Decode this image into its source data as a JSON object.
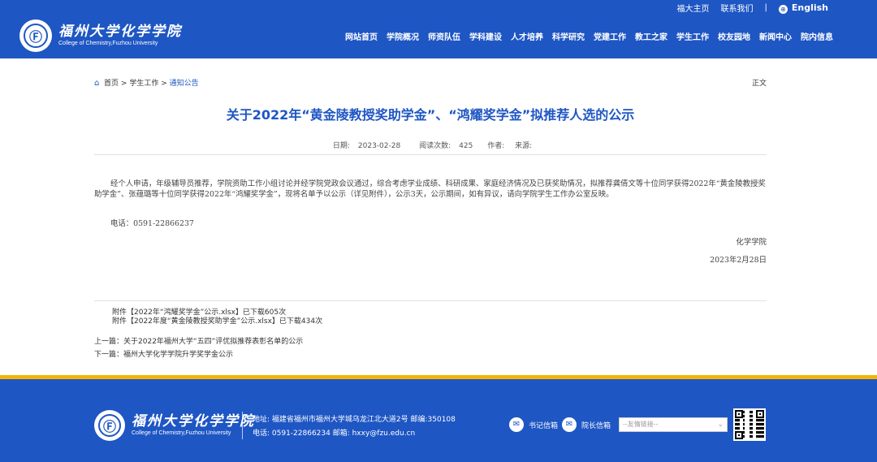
{
  "header": {
    "logo_cn": "福州大学化学学院",
    "logo_en": "College of Chemistry,Fuzhou University",
    "top_links": [
      "福大主页",
      "联系我们"
    ],
    "separator": "|",
    "english_label": "English",
    "nav": [
      "网站首页",
      "学院概况",
      "师资队伍",
      "学科建设",
      "人才培养",
      "科学研究",
      "党建工作",
      "教工之家",
      "学生工作",
      "校友园地",
      "新闻中心",
      "院内信息"
    ]
  },
  "breadcrumb": {
    "home": "首页",
    "sep1": ">",
    "section": "学生工作",
    "sep2": ">",
    "current": "通知公告"
  },
  "zhengwen": "正文",
  "article": {
    "title": "关于2022年“黄金陵教授奖助学金”、“鸿耀奖学金”拟推荐人选的公示",
    "date_label": "日期:",
    "date": "2023-02-28",
    "views_label": "阅读次数:",
    "views": "425",
    "author_label": "作者:",
    "source_label": "来源:",
    "paragraph": "经个人申请，年级辅导员推荐，学院资助工作小组讨论并经学院党政会议通过，综合考虑学业成绩、科研成果、家庭经济情况及已获奖助情况，拟推荐龚倩文等十位同学获得2022年“黄金陵教授奖助学金”、张蕴璐等十位同学获得2022年“鸿耀奖学金”，现将名单予以公示（详见附件），公示3天，公示期间，如有异议，请向学院学生工作办公室反映。",
    "phone": "电话：0591-22866237",
    "sign_org": "化学学院",
    "sign_date": "2023年2月28日"
  },
  "attachments": [
    "附件【2022年“鸿耀奖学金”公示.xlsx】已下载605次",
    "附件【2022年度“黄金陵教授奖助学金”公示.xlsx】已下载434次"
  ],
  "prev": {
    "label": "上一篇：",
    "title": "关于2022年福州大学“五四”评优拟推荐表彰名单的公示"
  },
  "next": {
    "label": "下一篇：",
    "title": "福州大学化学学院升学奖学金公示"
  },
  "footer": {
    "logo_cn": "福州大学化学学院",
    "logo_en": "College of Chemistry,Fuzhou University",
    "address": "地址: 福建省福州市福州大学城乌龙江北大道2号 邮编:350108",
    "contact": "电话: 0591-22866234 邮箱: hxxy@fzu.edu.cn",
    "secretary_mail": "书记信箱",
    "dean_mail": "院长信箱",
    "links_placeholder": "--友情链接--"
  },
  "colors": {
    "brand_blue": "#1e56c4",
    "accent_yellow": "#f4b400"
  }
}
